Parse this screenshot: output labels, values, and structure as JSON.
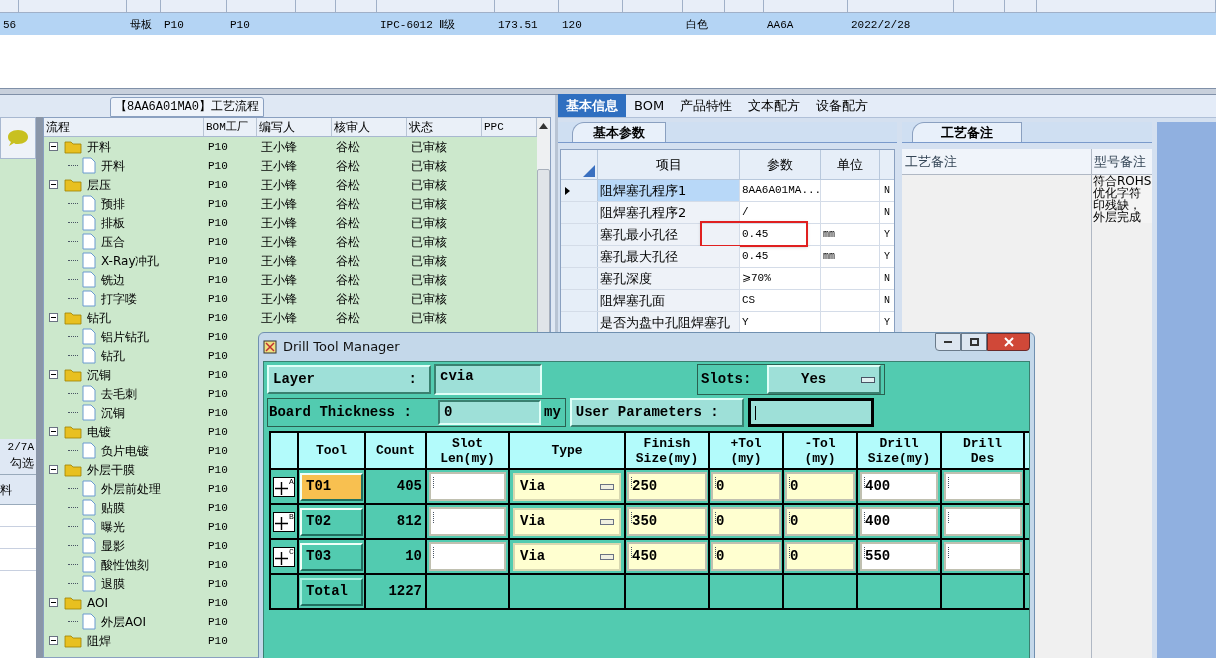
{
  "top_grid": {
    "rows": [
      {
        "selected": true,
        "cells": [
          "56",
          null,
          "母板",
          "P10",
          "P10",
          null,
          null,
          "IPC-6012 Ⅱ级",
          "173.51",
          "120",
          null,
          "白色",
          null,
          "AA6A",
          "2022/2/28",
          null,
          null,
          null
        ]
      }
    ]
  },
  "left_strip": {
    "texts": [
      "2/7A",
      "勾选",
      "料"
    ]
  },
  "flow": {
    "title": "【8AA6A01MA0】工艺流程",
    "columns": [
      "流程",
      "BOM工厂",
      "编写人",
      "核审人",
      "状态",
      "PPC"
    ],
    "rows": [
      {
        "name": "开料",
        "bom": "P10",
        "writer": "王小锋",
        "reviewer": "谷松",
        "status": "已审核",
        "expanded": true,
        "children": [
          {
            "name": "开料",
            "bom": "P10",
            "writer": "王小锋",
            "reviewer": "谷松",
            "status": "已审核"
          }
        ]
      },
      {
        "name": "层压",
        "bom": "P10",
        "writer": "王小锋",
        "reviewer": "谷松",
        "status": "已审核",
        "expanded": true,
        "children": [
          {
            "name": "预排",
            "bom": "P10",
            "writer": "王小锋",
            "reviewer": "谷松",
            "status": "已审核"
          },
          {
            "name": "排板",
            "bom": "P10",
            "writer": "王小锋",
            "reviewer": "谷松",
            "status": "已审核"
          },
          {
            "name": "压合",
            "bom": "P10",
            "writer": "王小锋",
            "reviewer": "谷松",
            "status": "已审核"
          },
          {
            "name": "X-Ray冲孔",
            "bom": "P10",
            "writer": "王小锋",
            "reviewer": "谷松",
            "status": "已审核"
          },
          {
            "name": "铣边",
            "bom": "P10",
            "writer": "王小锋",
            "reviewer": "谷松",
            "status": "已审核"
          },
          {
            "name": "打字喽",
            "bom": "P10",
            "writer": "王小锋",
            "reviewer": "谷松",
            "status": "已审核"
          }
        ]
      },
      {
        "name": "钻孔",
        "bom": "P10",
        "writer": "王小锋",
        "reviewer": "谷松",
        "status": "已审核",
        "expanded": true,
        "children": [
          {
            "name": "铝片钻孔",
            "bom": "P10"
          },
          {
            "name": "钻孔",
            "bom": "P10"
          }
        ]
      },
      {
        "name": "沉铜",
        "bom": "P10",
        "expanded": true,
        "children": [
          {
            "name": "去毛刺",
            "bom": "P10"
          },
          {
            "name": "沉铜",
            "bom": "P10"
          }
        ]
      },
      {
        "name": "电镀",
        "bom": "P10",
        "expanded": true,
        "children": [
          {
            "name": "负片电镀",
            "bom": "P10"
          }
        ]
      },
      {
        "name": "外层干膜",
        "bom": "P10",
        "expanded": true,
        "children": [
          {
            "name": "外层前处理",
            "bom": "P10"
          },
          {
            "name": "贴膜",
            "bom": "P10"
          },
          {
            "name": "曝光",
            "bom": "P10"
          },
          {
            "name": "显影",
            "bom": "P10"
          },
          {
            "name": "酸性蚀刻",
            "bom": "P10"
          },
          {
            "name": "退膜",
            "bom": "P10"
          }
        ]
      },
      {
        "name": "AOI",
        "bom": "P10",
        "expanded": true,
        "children": [
          {
            "name": "外层AOI",
            "bom": "P10"
          }
        ]
      },
      {
        "name": "阻焊",
        "bom": "P10",
        "expanded": true
      }
    ]
  },
  "tabs": [
    {
      "label": "基本信息",
      "selected": true
    },
    {
      "label": "BOM",
      "selected": false
    },
    {
      "label": "产品特性",
      "selected": false
    },
    {
      "label": "文本配方",
      "selected": false
    },
    {
      "label": "设备配方",
      "selected": false
    }
  ],
  "params": {
    "tab": "基本参数",
    "columns": [
      "项目",
      "参数",
      "单位"
    ],
    "rows": [
      {
        "current": true,
        "marked": false,
        "item": "阻焊塞孔程序1",
        "value": "8AA6A01MA...",
        "flag": "N"
      },
      {
        "current": false,
        "marked": false,
        "item": "阻焊塞孔程序2",
        "value": "/",
        "flag": "N"
      },
      {
        "current": false,
        "marked": true,
        "item": "塞孔最小孔径",
        "value": "0.45",
        "unit": "mm",
        "flag": "Y"
      },
      {
        "current": false,
        "marked": false,
        "item": "塞孔最大孔径",
        "value": "0.45",
        "unit": "mm",
        "flag": "Y"
      },
      {
        "current": false,
        "marked": false,
        "item": "塞孔深度",
        "value": "⩾70%",
        "flag": "N"
      },
      {
        "current": false,
        "marked": false,
        "item": "阻焊塞孔面",
        "value": "CS",
        "flag": "N"
      },
      {
        "current": false,
        "marked": false,
        "item": "是否为盘中孔阻焊塞孔",
        "value": "Y",
        "flag": "Y"
      }
    ]
  },
  "notes": {
    "tab": "工艺备注",
    "columns": [
      "工艺备注",
      "型号备注"
    ],
    "lines": [
      "符合ROHS",
      "优化字符",
      "印残缺，",
      "外层完成"
    ]
  },
  "dialog": {
    "title": "Drill Tool Manager",
    "layer": {
      "label": "Layer",
      "colon": ":",
      "value": "cvia"
    },
    "slots": {
      "label": "Slots:",
      "value": "Yes"
    },
    "board_thickness": {
      "label": "Board Thickness :",
      "value": "0",
      "unit": "my"
    },
    "user_parameters": {
      "label": "User Parameters :"
    },
    "columns": [
      "Tool",
      "Count",
      "Slot\nLen(my)",
      "Type",
      "Finish\nSize(my)",
      "+Tol\n(my)",
      "-Tol\n(my)",
      "Drill\nSize(my)",
      "Drill\nDes"
    ],
    "rows": [
      {
        "kind": "tool",
        "badge": "A",
        "tool": "T01",
        "selected": true,
        "count": "405",
        "type": "Via",
        "finish": "250",
        "plus_tol": "0",
        "minus_tol": "0",
        "drill_size": "400"
      },
      {
        "kind": "tool",
        "badge": "B",
        "tool": "T02",
        "selected": false,
        "count": "812",
        "type": "Via",
        "finish": "350",
        "plus_tol": "0",
        "minus_tol": "0",
        "drill_size": "400"
      },
      {
        "kind": "tool",
        "badge": "C",
        "tool": "T03",
        "selected": false,
        "count": "10",
        "type": "Via",
        "finish": "450",
        "plus_tol": "0",
        "minus_tol": "0",
        "drill_size": "550"
      },
      {
        "kind": "total",
        "tool": "Total",
        "count": "1227"
      }
    ]
  }
}
